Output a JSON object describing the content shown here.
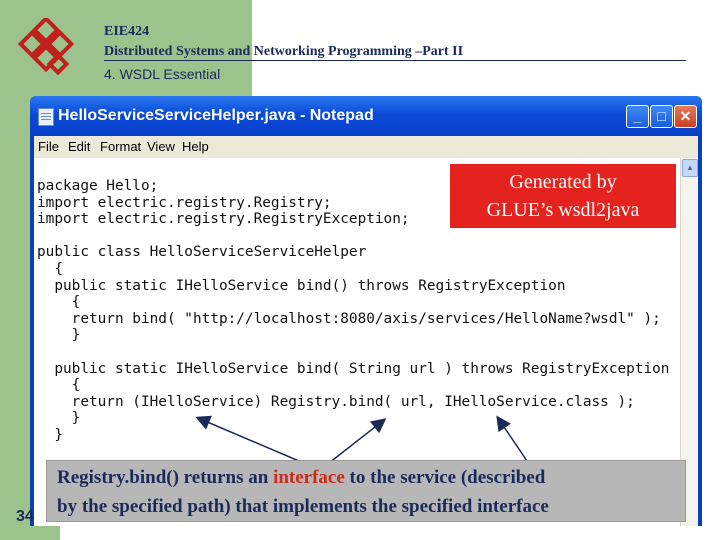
{
  "header": {
    "course_code": "EIE424",
    "course_name": "Distributed Systems and Networking Programming –Part II",
    "topic": "4. WSDL Essential"
  },
  "slide_number": "34",
  "window": {
    "title": "HelloServiceServiceHelper.java - Notepad",
    "buttons": {
      "minimize": "_",
      "maximize": "□",
      "close": "✕"
    }
  },
  "menu": {
    "file": "File",
    "edit": "Edit",
    "format": "Format",
    "view": "View",
    "help": "Help"
  },
  "code_lines": [
    "package Hello;",
    "import electric.registry.Registry;",
    "import electric.registry.RegistryException;",
    "",
    "public class HelloServiceServiceHelper",
    "  {",
    "  public static IHelloService bind() throws RegistryException",
    "    {",
    "    return bind( \"http://localhost:8080/axis/services/HelloName?wsdl\" );",
    "    }",
    "",
    "  public static IHelloService bind( String url ) throws RegistryException",
    "    {",
    "    return (IHelloService) Registry.bind( url, IHelloService.class );",
    "    }",
    "  }"
  ],
  "callout": {
    "line1": "Generated by",
    "line2": "GLUE’s wsdl2java"
  },
  "explanation": {
    "part1": "Registry.bind() returns an ",
    "highlight": "interface",
    "part2": " to the service (described",
    "line2": "by the specified path) that implements the specified interface"
  },
  "colors": {
    "accent_green": "#9cc38c",
    "titlebar_blue": "#0a4ad8",
    "callout_red": "#e4231e",
    "text_navy": "#1a2a5a"
  }
}
